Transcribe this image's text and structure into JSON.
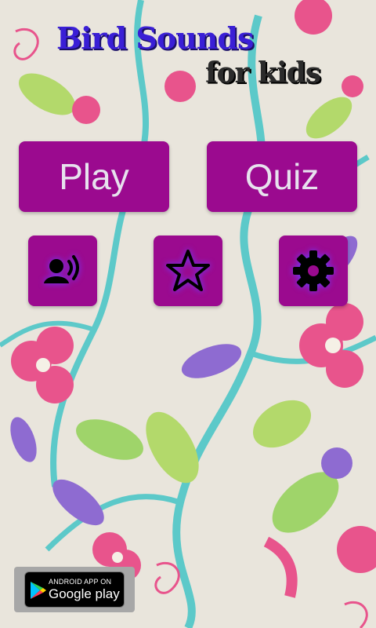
{
  "title": {
    "line1": "Bird Sounds",
    "line2": "for kids"
  },
  "buttons": {
    "play": "Play",
    "quiz": "Quiz"
  },
  "icons": {
    "sounds": "bird-sounds-icon",
    "favorites": "star-icon",
    "settings": "gear-icon"
  },
  "badge": {
    "top": "ANDROID APP ON",
    "main": "Google play"
  },
  "colors": {
    "button_bg": "#9b0a8f",
    "button_text": "#e7e2ee",
    "title_color": "#3a1fd6",
    "icon_glow": "#6a3cff"
  }
}
